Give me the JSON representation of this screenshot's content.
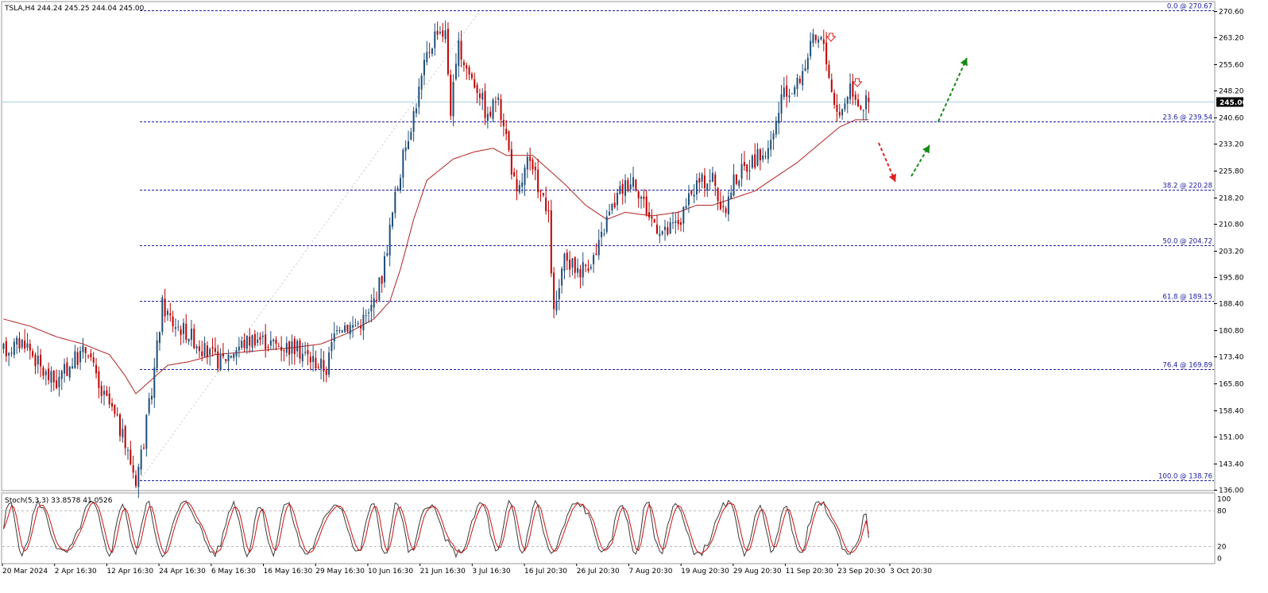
{
  "header": {
    "symbol_info": "TSLA,H4  244.24 245.25 244.04 245.00",
    "stoch_info": "Stoch(5,3,3) 33.8578 41.0526"
  },
  "colors": {
    "bull": "#1f4e79",
    "bear": "#c00000",
    "ma": "#b22222",
    "fib": "#1b1b9e",
    "price_line": "#a6d2e8",
    "stoch_main": "#3a3a3a",
    "stoch_signal": "#d01010",
    "arrow_down": "#e02020",
    "arrow_up": "#138a13"
  },
  "chart_data": [
    {
      "type": "candlestick",
      "symbol": "TSLA",
      "timeframe": "H4",
      "ylim": [
        136.0,
        273.0
      ],
      "y_ticks": [
        270.6,
        263.2,
        255.6,
        248.2,
        240.6,
        233.2,
        225.8,
        218.2,
        210.8,
        203.2,
        195.8,
        188.4,
        180.8,
        173.4,
        165.8,
        158.4,
        151.0,
        143.4,
        136.0
      ],
      "x_ticks": [
        "20 Mar 2024",
        "2 Apr 16:30",
        "12 Apr 16:30",
        "24 Apr 16:30",
        "6 May 16:30",
        "16 May 16:30",
        "29 May 16:30",
        "10 Jun 16:30",
        "21 Jun 16:30",
        "3 Jul 16:30",
        "16 Jul 20:30",
        "26 Jul 20:30",
        "7 Aug 20:30",
        "19 Aug 20:30",
        "29 Aug 20:30",
        "11 Sep 20:30",
        "23 Sep 20:30",
        "3 Oct 20:30"
      ],
      "current_price": 245.0,
      "current_price_label": "245.00",
      "fibonacci_levels": [
        {
          "label": "0.0 @ 270.67",
          "price": 270.67
        },
        {
          "label": "23.6 @ 239.54",
          "price": 239.54
        },
        {
          "label": "38.2 @ 220.28",
          "price": 220.28
        },
        {
          "label": "50.0 @ 204.72",
          "price": 204.72
        },
        {
          "label": "61.8 @ 189.15",
          "price": 189.15
        },
        {
          "label": "76.4 @ 169.89",
          "price": 169.89
        },
        {
          "label": "100.0 @ 138.76",
          "price": 138.76
        }
      ],
      "price_path_keypoints": [
        [
          0,
          175
        ],
        [
          8,
          178
        ],
        [
          15,
          169
        ],
        [
          20,
          166
        ],
        [
          26,
          172
        ],
        [
          32,
          176
        ],
        [
          36,
          164
        ],
        [
          40,
          160
        ],
        [
          44,
          153
        ],
        [
          48,
          144
        ],
        [
          50,
          139
        ],
        [
          53,
          150
        ],
        [
          56,
          164
        ],
        [
          60,
          188
        ],
        [
          64,
          183
        ],
        [
          70,
          180
        ],
        [
          76,
          175
        ],
        [
          82,
          172
        ],
        [
          88,
          176
        ],
        [
          95,
          179
        ],
        [
          102,
          177
        ],
        [
          110,
          176
        ],
        [
          116,
          173
        ],
        [
          122,
          170
        ],
        [
          126,
          183
        ],
        [
          132,
          182
        ],
        [
          138,
          185
        ],
        [
          143,
          196
        ],
        [
          148,
          218
        ],
        [
          152,
          233
        ],
        [
          156,
          245
        ],
        [
          160,
          258
        ],
        [
          164,
          266
        ],
        [
          167,
          264
        ],
        [
          169,
          243
        ],
        [
          172,
          260
        ],
        [
          176,
          253
        ],
        [
          180,
          248
        ],
        [
          183,
          240
        ],
        [
          186,
          246
        ],
        [
          189,
          240
        ],
        [
          194,
          218
        ],
        [
          198,
          228
        ],
        [
          202,
          222
        ],
        [
          206,
          212
        ],
        [
          208,
          185
        ],
        [
          212,
          200
        ],
        [
          218,
          198
        ],
        [
          224,
          202
        ],
        [
          228,
          212
        ],
        [
          233,
          220
        ],
        [
          238,
          224
        ],
        [
          244,
          213
        ],
        [
          250,
          208
        ],
        [
          256,
          212
        ],
        [
          262,
          222
        ],
        [
          268,
          224
        ],
        [
          272,
          213
        ],
        [
          276,
          223
        ],
        [
          282,
          228
        ],
        [
          286,
          230
        ],
        [
          290,
          232
        ],
        [
          294,
          246
        ],
        [
          300,
          250
        ],
        [
          306,
          262
        ],
        [
          310,
          262
        ],
        [
          313,
          248
        ],
        [
          316,
          241
        ],
        [
          320,
          250
        ],
        [
          324,
          244
        ],
        [
          327,
          245
        ]
      ],
      "moving_average_keypoints": [
        [
          0,
          184
        ],
        [
          10,
          182
        ],
        [
          20,
          179
        ],
        [
          30,
          177
        ],
        [
          40,
          174
        ],
        [
          46,
          168
        ],
        [
          50,
          163
        ],
        [
          56,
          167
        ],
        [
          62,
          171
        ],
        [
          70,
          172
        ],
        [
          80,
          174
        ],
        [
          95,
          175
        ],
        [
          110,
          176
        ],
        [
          120,
          177
        ],
        [
          130,
          180
        ],
        [
          140,
          184
        ],
        [
          146,
          189
        ],
        [
          150,
          198
        ],
        [
          155,
          212
        ],
        [
          160,
          223
        ],
        [
          170,
          229
        ],
        [
          178,
          231
        ],
        [
          185,
          232
        ],
        [
          190,
          230
        ],
        [
          195,
          230
        ],
        [
          200,
          230
        ],
        [
          206,
          226
        ],
        [
          212,
          222
        ],
        [
          220,
          216
        ],
        [
          228,
          212
        ],
        [
          235,
          214
        ],
        [
          245,
          213
        ],
        [
          255,
          214
        ],
        [
          262,
          216
        ],
        [
          268,
          216
        ],
        [
          276,
          218
        ],
        [
          284,
          220
        ],
        [
          292,
          224
        ],
        [
          300,
          228
        ],
        [
          308,
          233
        ],
        [
          316,
          238
        ],
        [
          322,
          240
        ],
        [
          327,
          240
        ]
      ],
      "annotations": [
        "down-arrow marker at peak near 270.6 (23 Sep)",
        "down-arrow marker at lower high near 255 (3 Oct)",
        "red dashed arrow pointing down toward ~226",
        "green dashed arrow pointing up toward ~236",
        "green dashed arrow pointing up toward ~262"
      ]
    },
    {
      "type": "line",
      "name": "Stoch(5,3,3)",
      "ylim": [
        0,
        100
      ],
      "levels": [
        80,
        20
      ],
      "y_ticks": [
        100,
        80,
        20,
        0
      ],
      "main_last": 33.8578,
      "signal_last": 41.0526
    }
  ]
}
